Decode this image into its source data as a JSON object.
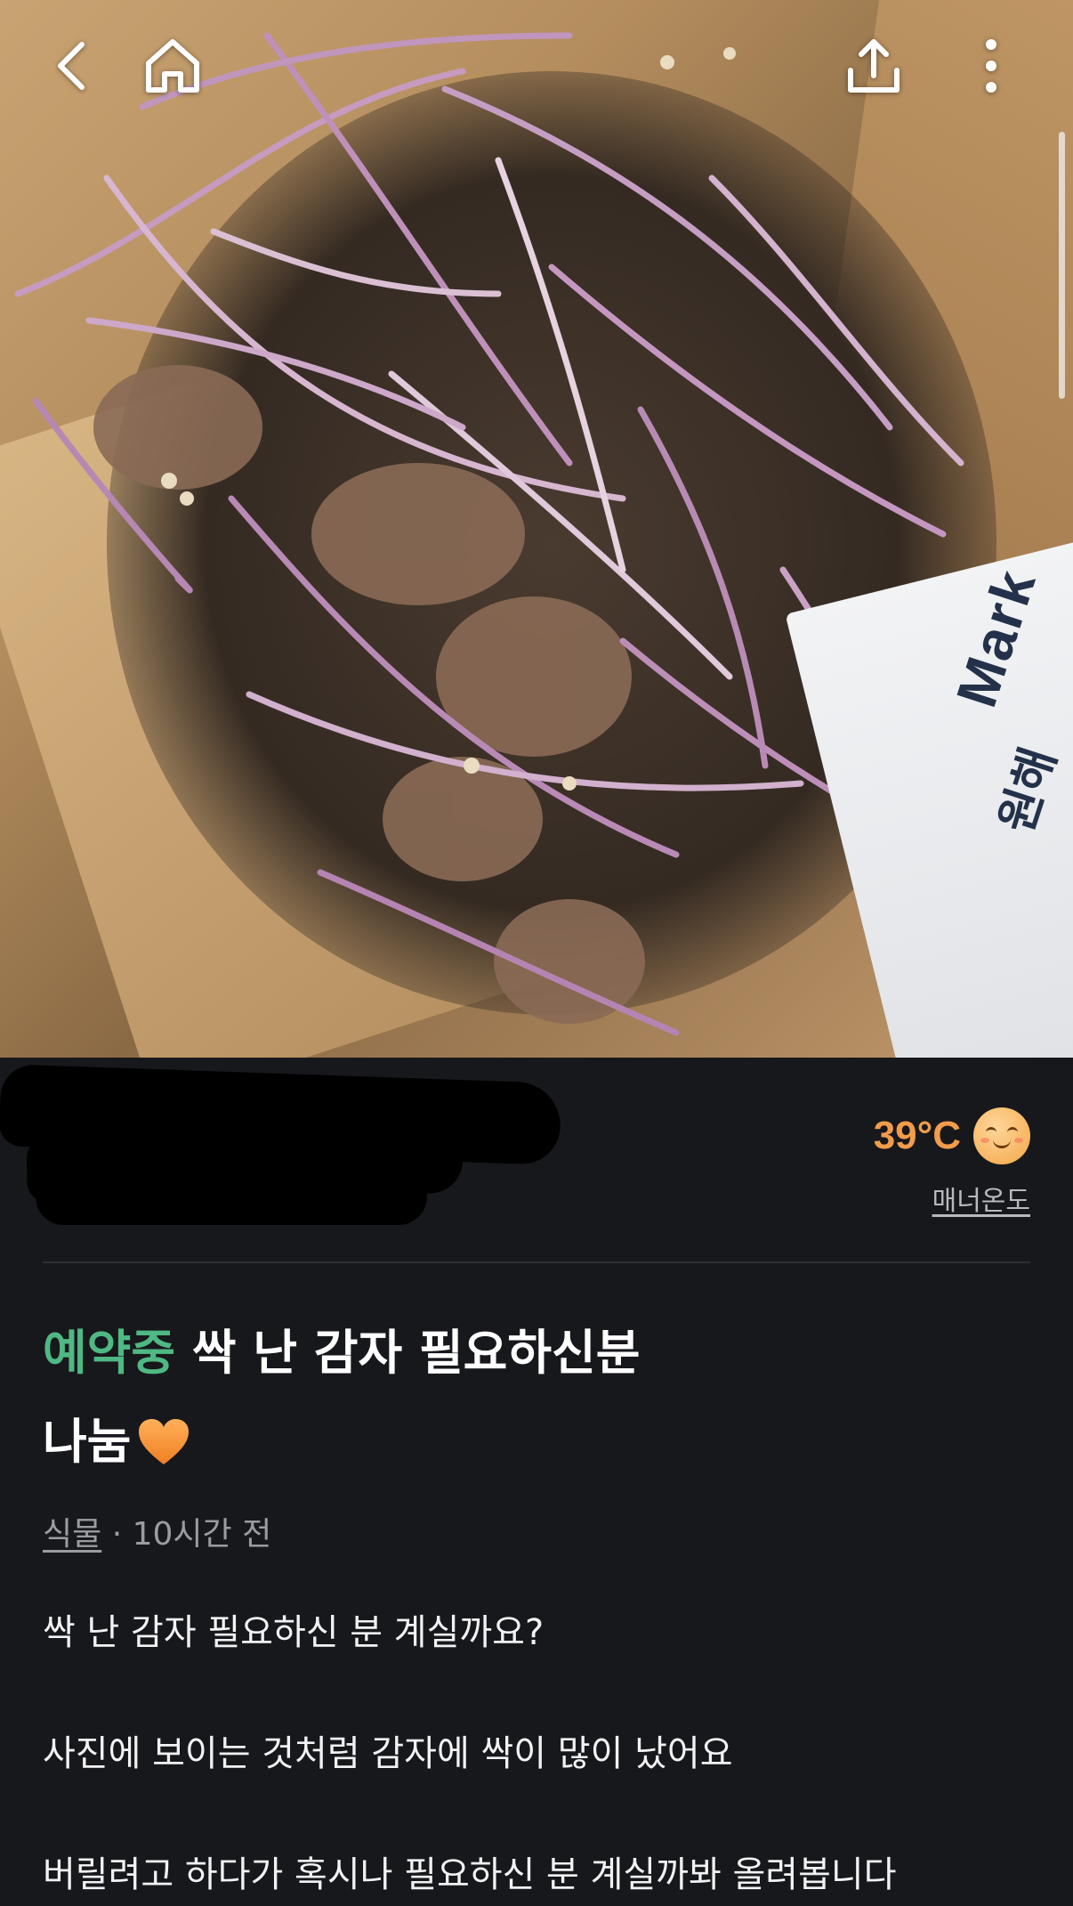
{
  "nav": {
    "back_icon": "chevron-left-icon",
    "home_icon": "home-icon",
    "share_icon": "share-upload-icon",
    "more_icon": "more-vertical-icon"
  },
  "photo": {
    "description_label": "",
    "paper_text_line1": "Mark",
    "paper_text_line2": "원해"
  },
  "seller": {
    "name_redacted": true,
    "manner_temperature": "39°C",
    "manner_label": "매너온도",
    "manner_face_icon": "smiling-face-icon"
  },
  "post": {
    "status": "예약중",
    "title_line1": "싹 난 감자 필요하신분",
    "title_line2": "나눔",
    "title_emoji": "orange-heart-icon",
    "category": "식물",
    "separator": " · ",
    "time_ago": "10시간 전",
    "body": [
      "싹 난 감자 필요하신 분 계실까요?",
      "사진에 보이는 것처럼 감자에 싹이 많이 났어요",
      "버릴려고 하다가 혹시나 필요하신 분 계실까봐 올려봅니다"
    ]
  },
  "colors": {
    "background": "#17181c",
    "status_green": "#4fb883",
    "temperature_orange": "#f29c4b",
    "heart_orange": "#f7943a",
    "muted_text": "#9a9ca2"
  }
}
